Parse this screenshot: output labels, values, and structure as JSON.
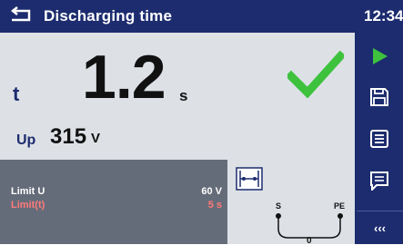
{
  "header": {
    "title": "Discharging time",
    "clock": "12:34",
    "back_icon": "return-arrow-icon"
  },
  "result": {
    "t_label": "t",
    "t_value": "1.2",
    "t_unit": "s",
    "status_icon": "check-icon",
    "up_label": "Up",
    "up_value": "315",
    "up_unit": "V"
  },
  "limits": {
    "u_label": "Limit U",
    "u_value": "60 V",
    "t_label": "Limit(t)",
    "t_value": "5 s"
  },
  "probe": {
    "left_label": "S",
    "right_label": "PE",
    "mid_label": "0"
  },
  "sidebar": {
    "run_icon": "play-icon",
    "save_icon": "save-icon",
    "list_icon": "list-icon",
    "notes_icon": "notes-icon",
    "more_label": "‹‹‹"
  },
  "colors": {
    "header_bg": "#1c2c6e",
    "panel_bg": "#dde1e6",
    "limits_bg": "#656c79",
    "pass_green": "#3ec23e",
    "limit_t_red": "#ff7a7a",
    "run_green": "#3ec23e"
  }
}
